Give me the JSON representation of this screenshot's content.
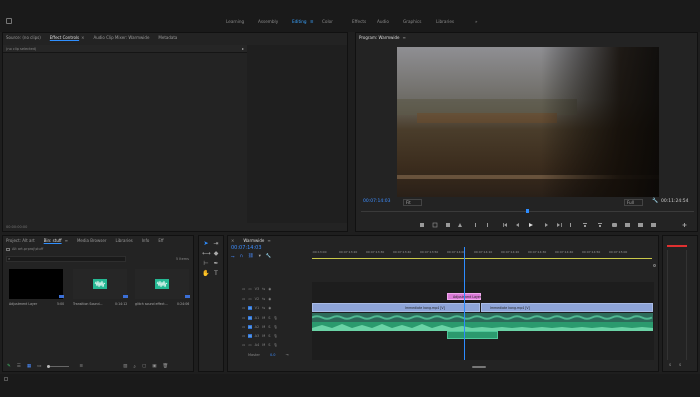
{
  "header": {
    "workspaces": [
      "Learning",
      "Assembly",
      "Editing",
      "Color",
      "Effects",
      "Audio",
      "Graphics",
      "Libraries"
    ],
    "active_workspace": "Editing",
    "more": "»"
  },
  "source_panel": {
    "tabs": [
      "Source: (no clips)",
      "Effect Controls",
      "Audio Clip Mixer: Warmwide",
      "Metadata"
    ],
    "active_tab": "Effect Controls",
    "no_clip_label": "(no clip selected)",
    "timecode": "00:00:00:00"
  },
  "program_panel": {
    "title": "Program: Warmwide",
    "timecode": "00:07:14:03",
    "fit": "Fit",
    "quality": "Full",
    "duration": "00:11:24:54"
  },
  "project_panel": {
    "tabs": [
      "Project: Alt art",
      "Bin: stuff",
      "Media Browser",
      "Libraries",
      "Info",
      "Eff"
    ],
    "active_tab": "Bin: stuff",
    "path": "Alt art.prproj\\stuff",
    "item_count": "5 Items",
    "items": [
      {
        "name": "Adjustment Layer",
        "duration": "5:00",
        "type": "black"
      },
      {
        "name": "Transition Sound...",
        "duration": "0:14:12",
        "type": "audio"
      },
      {
        "name": "glitch sound effect...",
        "duration": "0:24:06",
        "type": "audio"
      }
    ]
  },
  "timeline": {
    "title": "Warmwide",
    "timecode": "00:07:14:03",
    "ruler": [
      ":00:13:00",
      "00:07:13:20",
      "00:07:13:30",
      "00:07:13:40",
      "00:07:13:50",
      "00:07:14:00",
      "00:07:14:10",
      "00:07:14:20",
      "00:07:14:30",
      "00:07:14:40",
      "00:07:14:50",
      "00:07:15:00",
      "00:07:15:10"
    ],
    "video_tracks": [
      "V3",
      "V2",
      "V1"
    ],
    "audio_tracks": [
      "A1",
      "A2",
      "A3",
      "A4"
    ],
    "master_label": "Master",
    "master_value": "0.0",
    "clips": {
      "adjustment": "Adjustment Layer",
      "v1_left": "Immediate kang.mp4 [V]",
      "v1_right": "Immediate kang.mp4 [V]"
    }
  },
  "colors": {
    "accent": "#2d8cff",
    "video_clip": "#7f9bd6",
    "audio_clip": "#2b9a6e",
    "adjustment_clip": "#d97ad6",
    "playhead": "#2d8cff",
    "meter_red": "#e03030"
  },
  "icons": [
    "panel-menu-icon",
    "add-marker-icon",
    "step-back-icon",
    "play-icon",
    "step-forward-icon",
    "lift-icon",
    "extract-icon",
    "export-frame-icon",
    "wrench-icon",
    "selection-tool-icon",
    "track-select-icon",
    "ripple-edit-icon",
    "razor-icon",
    "slip-icon",
    "pen-icon",
    "hand-icon",
    "type-icon",
    "eye-icon",
    "lock-icon",
    "mute-icon",
    "solo-icon",
    "mic-icon",
    "list-view-icon",
    "icon-view-icon",
    "new-bin-icon",
    "new-item-icon",
    "trash-icon",
    "search-icon"
  ]
}
